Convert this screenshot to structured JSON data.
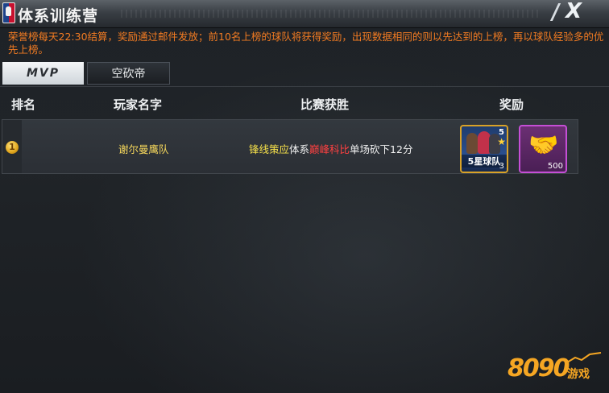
{
  "window": {
    "title": "体系训练营",
    "close_label": "X"
  },
  "notice": "荣誉榜每天22:30结算，奖励通过邮件发放；前10名上榜的球队将获得奖励，出现数据相同的则以先达到的上榜，再以球队经验多的优先上榜。",
  "tabs": [
    {
      "label": "MVP",
      "active": true
    },
    {
      "label": "空砍帝",
      "active": false
    }
  ],
  "columns": {
    "rank": "排名",
    "player": "玩家名字",
    "win": "比赛获胜",
    "reward": "奖励"
  },
  "rows": [
    {
      "rank": "1",
      "player": "谢尔曼鹰队",
      "win_parts": [
        "锋线策应",
        "体系",
        "巅峰科比",
        "单场砍下12分"
      ],
      "rewards": [
        {
          "name": "5星球队",
          "stars": "5",
          "count": "3"
        },
        {
          "name": "handshake",
          "count": "500"
        }
      ]
    }
  ],
  "watermark": {
    "number": "8090",
    "text": "游戏"
  },
  "colors": {
    "notice": "#f27b22",
    "player_name": "#f7d85c",
    "highlight_yellow": "#f7e14a",
    "highlight_red": "#ff4040"
  }
}
